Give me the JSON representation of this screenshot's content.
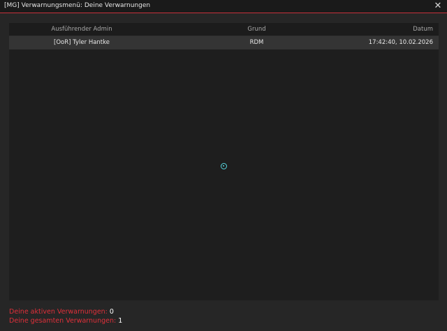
{
  "window": {
    "title": "[MG] Verwarnungsmenü: Deine Verwarnungen",
    "close_glyph": "✕"
  },
  "table": {
    "columns": [
      "Ausführender Admin",
      "Grund",
      "Datum"
    ],
    "rows": [
      {
        "admin": "[OoR] Tyler Hantke",
        "reason": "RDM",
        "date": "17:42:40, 10.02.2026"
      }
    ]
  },
  "footer": {
    "active_label": "Deine aktiven Verwarnungen:",
    "active_value": "0",
    "total_label": "Deine gesamten Verwarnungen:",
    "total_value": "1"
  },
  "colors": {
    "accent_red": "#e0303a",
    "cursor_cyan": "#56d8e0"
  },
  "icons": {
    "close": "close-icon",
    "cursor": "crosshair-cursor-icon"
  }
}
